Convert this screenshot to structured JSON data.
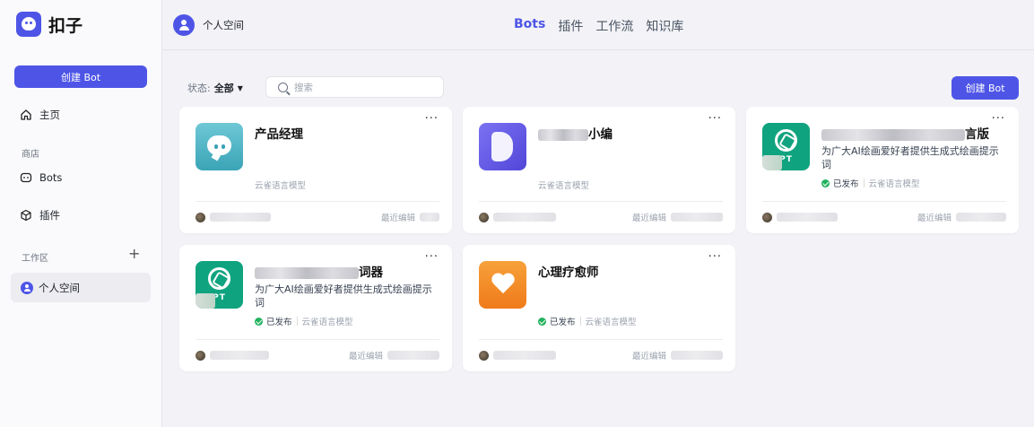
{
  "app": {
    "name": "扣子"
  },
  "sidebar": {
    "create_label": "创建 Bot",
    "home_label": "主页",
    "store_section": "商店",
    "bots_label": "Bots",
    "plugins_label": "插件",
    "workspace_section": "工作区",
    "add_symbol": "+",
    "personal_space_label": "个人空间"
  },
  "header": {
    "space_title": "个人空间",
    "tabs": [
      {
        "label": "Bots",
        "active": true
      },
      {
        "label": "插件",
        "active": false
      },
      {
        "label": "工作流",
        "active": false
      },
      {
        "label": "知识库",
        "active": false
      }
    ]
  },
  "toolbar": {
    "status_label": "状态:",
    "status_value": "全部",
    "search_placeholder": "搜索",
    "create_label": "创建 Bot"
  },
  "cards": [
    {
      "name": "产品经理",
      "name_prefix_hidden": false,
      "description": "",
      "published": false,
      "model": "云雀语言模型",
      "edited_label": "最近编辑",
      "icon": "chat-bubble-icon"
    },
    {
      "name": "小编",
      "name_prefix_hidden": true,
      "description": "",
      "published": false,
      "model": "云雀语言模型",
      "edited_label": "最近编辑",
      "icon": "bookmark-b-icon"
    },
    {
      "name": "言版",
      "name_prefix_hidden": true,
      "description": "为广大AI绘画爱好者提供生成式绘画提示词",
      "published": true,
      "published_label": "已发布",
      "model": "云雀语言模型",
      "edited_label": "最近编辑",
      "icon": "chatgpt-icon",
      "icon_text": "PT"
    },
    {
      "name": "词器",
      "name_prefix_hidden": true,
      "description": "为广大AI绘画爱好者提供生成式绘画提示词",
      "published": true,
      "published_label": "已发布",
      "model": "云雀语言模型",
      "edited_label": "最近编辑",
      "icon": "chatgpt-icon",
      "icon_text": "PT"
    },
    {
      "name": "心理疗愈师",
      "name_prefix_hidden": false,
      "description": "",
      "published": true,
      "published_label": "已发布",
      "model": "云雀语言模型",
      "edited_label": "最近编辑",
      "icon": "heart-icon"
    }
  ],
  "colors": {
    "accent": "#4e55e6",
    "success": "#22b35e",
    "background": "#f3f3f7"
  }
}
